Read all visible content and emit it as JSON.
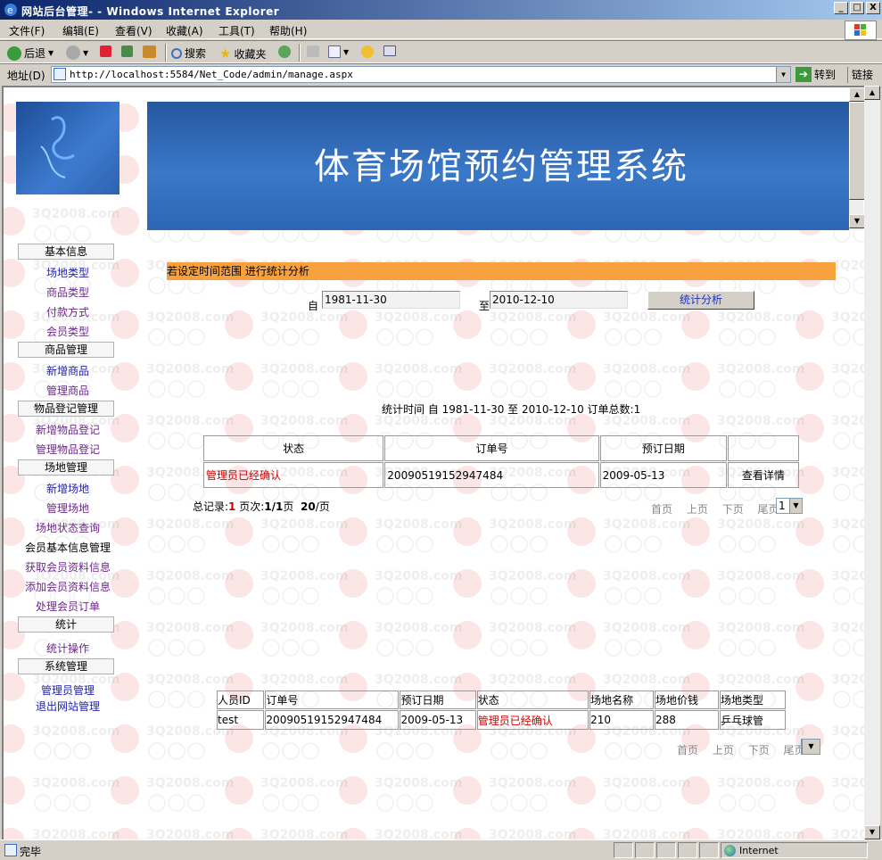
{
  "window": {
    "title": "网站后台管理- - Windows Internet Explorer",
    "minimize": "_",
    "restore": "□",
    "close": "X"
  },
  "menu": [
    "文件(F)",
    "编辑(E)",
    "查看(V)",
    "收藏(A)",
    "工具(T)",
    "帮助(H)"
  ],
  "toolbar": {
    "back": "后退",
    "search": "搜索",
    "favorites": "收藏夹"
  },
  "address": {
    "label": "地址(D)",
    "url": "http://localhost:5584/Net_Code/admin/manage.aspx",
    "go": "转到",
    "links": "链接"
  },
  "banner": {
    "title": "体育场馆预约管理系统"
  },
  "sidebar": {
    "sections": [
      {
        "title": "基本信息",
        "items": [
          "场地类型",
          "商品类型",
          "付款方式",
          "会员类型"
        ]
      },
      {
        "title": "商品管理",
        "items": [
          "新增商品",
          "管理商品"
        ]
      },
      {
        "title": "物品登记管理",
        "items": [
          "新增物品登记",
          "管理物品登记"
        ]
      },
      {
        "title": "场地管理",
        "items": [
          "新增场地",
          "管理场地"
        ]
      }
    ],
    "extra": [
      "场地状态查询",
      "会员基本信息管理",
      "获取会员资料信息",
      "添加会员资料信息",
      "处理会员订单"
    ],
    "stats": {
      "title": "统计",
      "item": "统计操作"
    },
    "system": {
      "title": "系统管理",
      "items": [
        "管理员管理",
        "退出网站管理"
      ]
    }
  },
  "main": {
    "range_hint": "若设定时间范围 进行统计分析",
    "from_label": "自",
    "from_value": "1981-11-30",
    "to_label": "至",
    "to_value": "2010-12-10",
    "stat_button": "统计分析",
    "stat_line": "统计时间 自 1981-11-30 至 2010-12-10 订单总数:1",
    "orders_table": {
      "headers": [
        "状态",
        "订单号",
        "预订日期",
        ""
      ],
      "rows": [
        [
          "管理员已经确认",
          "20090519152947484",
          "2009-05-13",
          "查看详情"
        ]
      ]
    },
    "summary": {
      "total_label": "总记录:",
      "total": "1",
      "pages_label": "页次:",
      "pages": "1/1",
      "pages_unit": "页",
      "per_page": "20",
      "per_page_unit": "/页"
    },
    "pager": [
      "首页",
      "上页",
      "下页",
      "尾页"
    ],
    "page_select": "1",
    "detail_table": {
      "headers": [
        "人员ID",
        "订单号",
        "预订日期",
        "状态",
        "场地名称",
        "场地价钱",
        "场地类型"
      ],
      "rows": [
        [
          "test",
          "20090519152947484",
          "2009-05-13",
          "管理员已经确认",
          "210",
          "288",
          "乒乓球管"
        ]
      ]
    }
  },
  "status": {
    "text": "完毕",
    "zone": "Internet"
  },
  "watermark": "3Q2008.com"
}
